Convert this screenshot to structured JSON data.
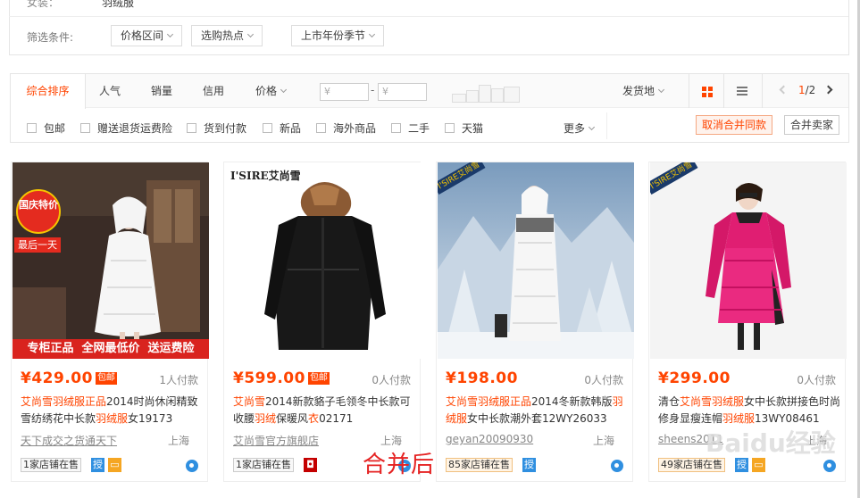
{
  "filter": {
    "prev_row_label": "女装：",
    "prev_row_value": "羽绒服",
    "label": "筛选条件:",
    "buttons": [
      "价格区间",
      "选购热点",
      "上市年份季节"
    ]
  },
  "sort": {
    "tabs": [
      "综合排序",
      "人气",
      "销量",
      "信用",
      "价格"
    ],
    "price_from_placeholder": "¥",
    "price_to_placeholder": "¥",
    "price_dash": "-",
    "ship_from": "发货地",
    "pager_current": "1",
    "pager_total": "/2",
    "checkboxes": [
      "包邮",
      "赠送退货运费险",
      "货到付款",
      "新品",
      "海外商品",
      "二手",
      "天猫"
    ],
    "more": "更多",
    "cancel_merge": "取消合并同款",
    "merge_sellers": "合并卖家",
    "accent_color": "#ff4400"
  },
  "products": [
    {
      "image_badge_top": "国庆特价",
      "image_badge_bottom": "最后一天",
      "image_banner": "专柜正品  全网最低价  送运费险",
      "price": "¥429.00",
      "baoyou": "包邮",
      "paycount": "1人付款",
      "title_parts": [
        "艾尚雪羽绒服正品",
        "2014时尚休闲精致雪纺绣花中长款",
        "羽绒服",
        "女19173"
      ],
      "shop": "天下成交之货通天下",
      "location": "上海",
      "stores": "1家店铺在售"
    },
    {
      "image_logo": "I'SIRE艾尚雪",
      "price": "¥599.00",
      "baoyou": "包邮",
      "paycount": "0人付款",
      "title_parts": [
        "艾尚雪",
        "2014新款貉子毛领冬中长款可收腰",
        "羽绒",
        "保暖风",
        "衣",
        "02171"
      ],
      "shop": "艾尚雪官方旗舰店",
      "location": "上海",
      "stores": "1家店铺在售"
    },
    {
      "image_logo": "I'SIRE艾尚雪",
      "price": "¥198.00",
      "paycount": "0人付款",
      "title_parts": [
        "艾尚雪羽绒服正品",
        "2014冬新款韩版",
        "羽绒服",
        "女中长款潮外套12WY26033"
      ],
      "shop": "geyan20090930",
      "location": "上海",
      "stores": "85家店铺在售"
    },
    {
      "image_logo": "I'SIRE艾尚雪",
      "price": "¥299.00",
      "paycount": "0人付款",
      "title_parts": [
        "清仓",
        "艾尚雪羽绒服",
        "女中长款拼接色时尚修身显瘦连帽",
        "羽绒服",
        "13WY08461"
      ],
      "shop": "sheens2011",
      "location": "上海",
      "stores": "49家店铺在售"
    }
  ],
  "annotation": "合并后",
  "watermark": "Baidu经验"
}
